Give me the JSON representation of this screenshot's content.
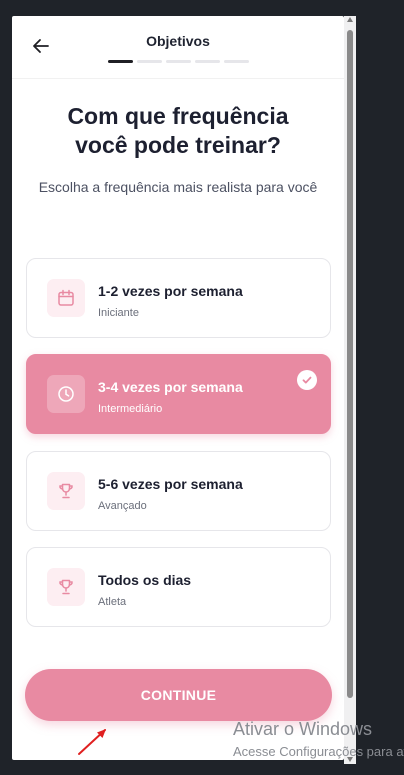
{
  "header": {
    "title": "Objetivos",
    "progress_steps": 5,
    "progress_current": 1
  },
  "question": {
    "title_line1": "Com que frequência",
    "title_line2": "você pode treinar?",
    "subtitle": "Escolha a frequência mais realista para você"
  },
  "options": [
    {
      "label": "1-2 vezes por semana",
      "level": "Iniciante",
      "icon": "calendar-icon",
      "selected": false
    },
    {
      "label": "3-4 vezes por semana",
      "level": "Intermediário",
      "icon": "clock-icon",
      "selected": true
    },
    {
      "label": "5-6 vezes por semana",
      "level": "Avançado",
      "icon": "trophy-icon",
      "selected": false
    },
    {
      "label": "Todos os dias",
      "level": "Atleta",
      "icon": "trophy-icon",
      "selected": false
    }
  ],
  "continue_label": "CONTINUE",
  "watermark": {
    "line1": "Ativar o Windows",
    "line2": "Acesse Configurações para ativar o Windows."
  },
  "colors": {
    "accent": "#e88aa2",
    "icon_bg": "#fdeef2",
    "text_dark": "#1d2030",
    "desktop_bg": "#1f2329"
  }
}
